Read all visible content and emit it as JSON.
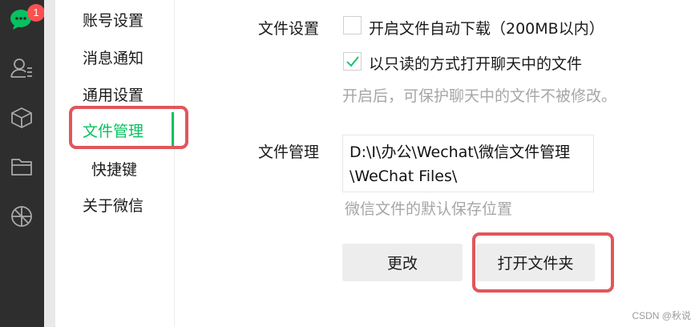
{
  "appbar": {
    "badge_count": "1",
    "icons": [
      "chat-icon",
      "contacts-icon",
      "box-icon",
      "folder-icon",
      "moments-icon"
    ]
  },
  "sidebar": {
    "items": [
      {
        "label": "账号设置"
      },
      {
        "label": "消息通知"
      },
      {
        "label": "通用设置"
      },
      {
        "label": "文件管理"
      },
      {
        "label": "快捷键"
      },
      {
        "label": "关于微信"
      }
    ],
    "active_index": 3
  },
  "file_settings": {
    "section_label": "文件设置",
    "auto_download": {
      "label": "开启文件自动下载（200MB以内）",
      "checked": false
    },
    "readonly_open": {
      "label": "以只读的方式打开聊天中的文件",
      "checked": true
    },
    "hint": "开启后，可保护聊天中的文件不被修改。"
  },
  "file_management": {
    "section_label": "文件管理",
    "path": "D:\\I\\办公\\Wechat\\微信文件管理\\WeChat Files\\",
    "hint": "微信文件的默认保存位置",
    "change_button": "更改",
    "open_folder_button": "打开文件夹"
  },
  "colors": {
    "accent": "#07c160",
    "badge": "#fa5151",
    "highlight": "#e0575b"
  },
  "watermark": "CSDN @秋说"
}
